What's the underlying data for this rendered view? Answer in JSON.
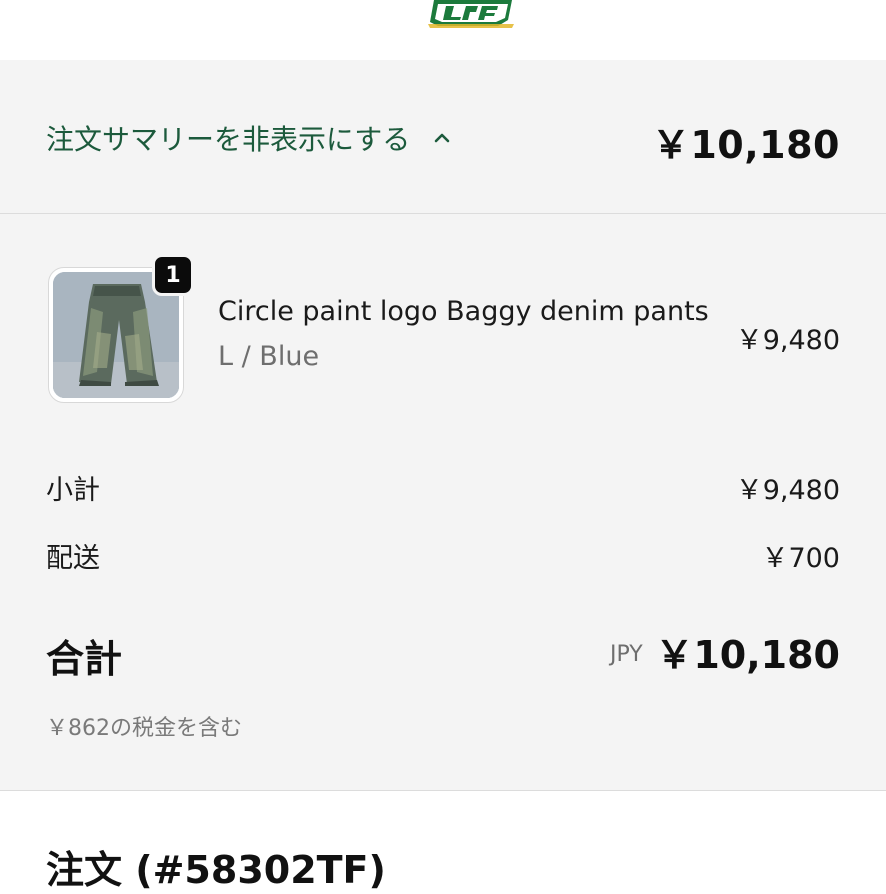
{
  "header": {
    "logo_icon": "brand-logo-icon",
    "accent": "#1c7a3c"
  },
  "summary_toggle": {
    "label": "注文サマリーを非表示にする",
    "chevron_icon": "chevron-up-icon",
    "total": "￥10,180",
    "link_color": "#1c5a3c"
  },
  "line_items": [
    {
      "quantity": "1",
      "name": "Circle paint logo Baggy denim pants",
      "variant": "L / Blue",
      "price": "￥9,480"
    }
  ],
  "totals": {
    "subtotal_label": "小計",
    "subtotal_value": "￥9,480",
    "shipping_label": "配送",
    "shipping_value": "￥700",
    "total_label": "合計",
    "currency": "JPY",
    "total_value": "￥10,180",
    "tax_note": "￥862の税金を含む"
  },
  "order": {
    "title": "注文 (#58302TF)"
  }
}
